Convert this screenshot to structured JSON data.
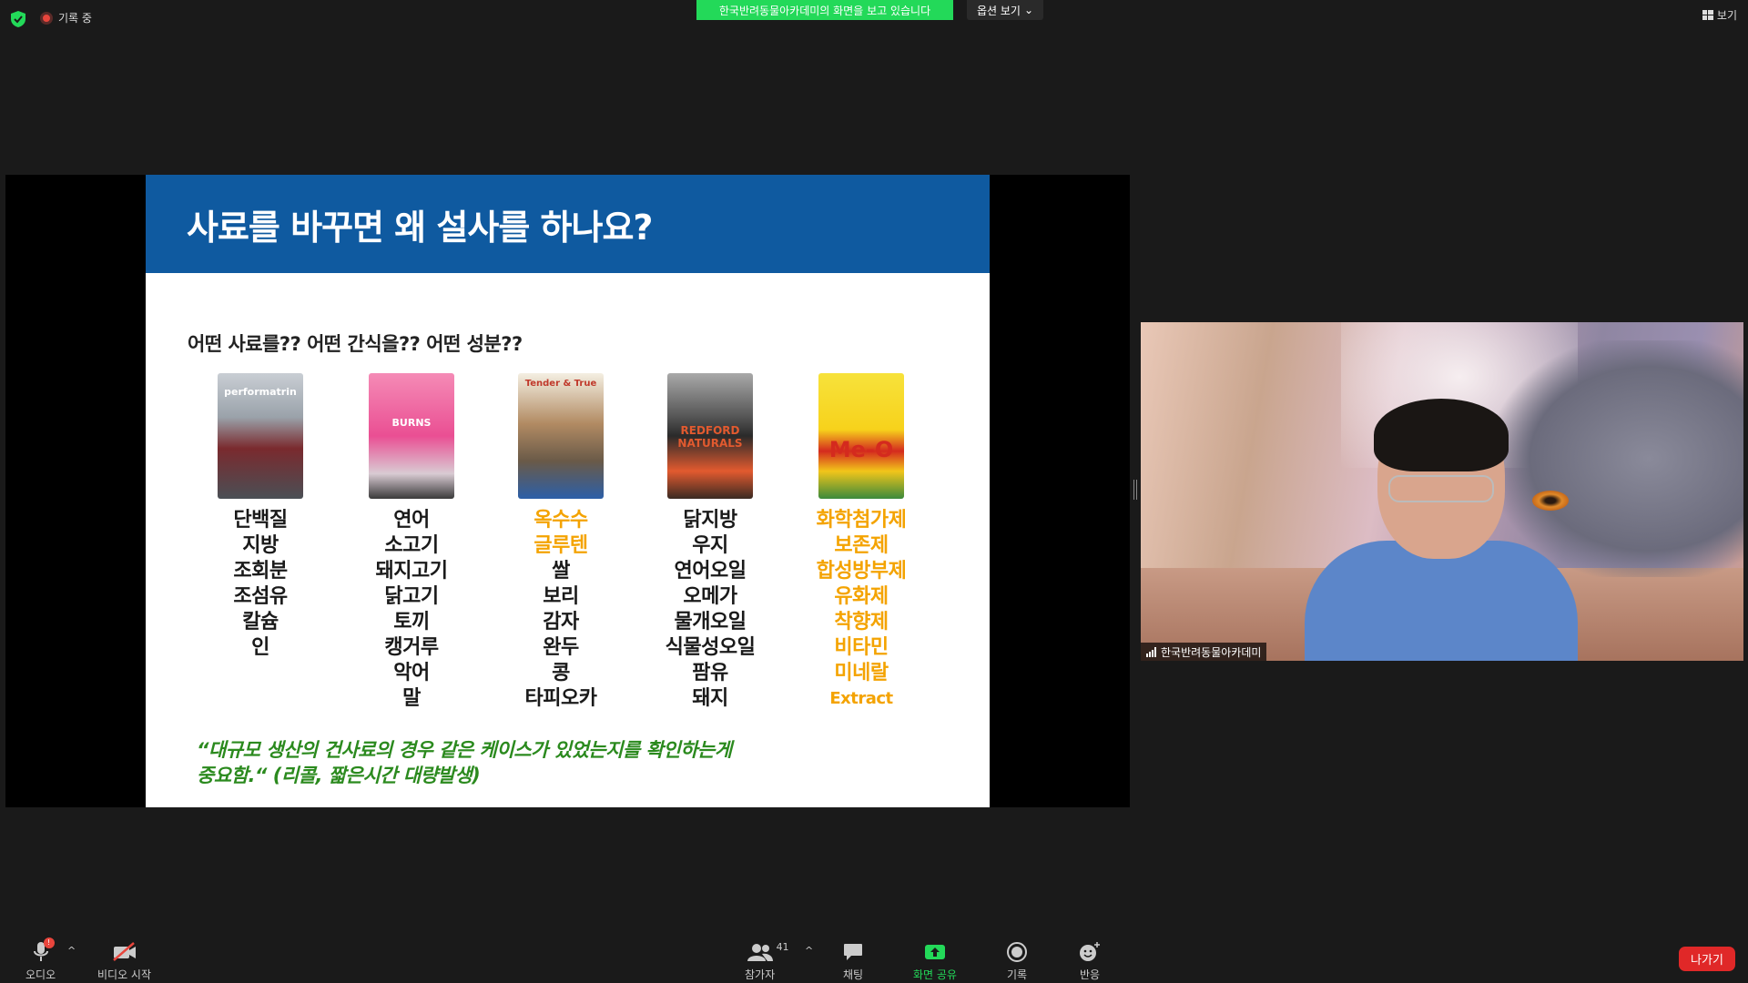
{
  "top_bar": {
    "recording_label": "기록 중",
    "viewing_banner": "한국반려동물아카데미의 화면을 보고 있습니다",
    "view_options_label": "옵션 보기",
    "view_button_label": "보기"
  },
  "slide": {
    "title": "사료를 바꾸면 왜 설사를 하나요?",
    "subtitle": "어떤 사료를?? 어떤 간식을?? 어떤 성분??",
    "columns": [
      {
        "product": "performatrin",
        "ingredients": [
          "단백질",
          "지방",
          "조회분",
          "조섬유",
          "칼슘",
          "인"
        ]
      },
      {
        "product": "BURNS",
        "ingredients": [
          "연어",
          "소고기",
          "돼지고기",
          "닭고기",
          "토끼",
          "캥거루",
          "악어",
          "말"
        ]
      },
      {
        "product": "Tender & True",
        "ingredients": [
          "옥수수",
          "글루텐",
          "쌀",
          "보리",
          "감자",
          "완두",
          "콩",
          "타피오카"
        ]
      },
      {
        "product": "REDFORD NATURALS",
        "ingredients": [
          "닭지방",
          "우지",
          "연어오일",
          "오메가",
          "물개오일",
          "식물성오일",
          "팜유",
          "돼지"
        ]
      },
      {
        "product": "Me-O",
        "ingredients": [
          "화학첨가제",
          "보존제",
          "합성방부제",
          "유화제",
          "착향제",
          "비타민",
          "미네랄",
          "Extract"
        ]
      }
    ],
    "quote_line1": "“대규모 생산의 건사료의  경우 같은 케이스가 있었는지를 확인하는게",
    "quote_line2": "중요함.“ (리콜, 짧은시간 대량발생)",
    "colors": {
      "header": "#0f5aa0",
      "highlight": "#f4a300",
      "quote": "#2b8a1e"
    }
  },
  "participant": {
    "name": "한국반려동물아카데미"
  },
  "toolbar": {
    "audio_label": "오디오",
    "audio_badge": "!",
    "video_label": "비디오 시작",
    "participants_label": "참가자",
    "participants_count": "41",
    "chat_label": "채팅",
    "share_label": "화면 공유",
    "record_label": "기록",
    "reactions_label": "반응",
    "leave_label": "나가기"
  },
  "icons": {
    "security": "shield-icon",
    "recording": "record-dot-icon",
    "view": "grid-icon",
    "audio": "microphone-icon",
    "video": "video-off-icon",
    "participants": "people-icon",
    "chat": "chat-bubble-icon",
    "share": "share-screen-icon",
    "record": "record-icon",
    "reactions": "emoji-icon"
  }
}
